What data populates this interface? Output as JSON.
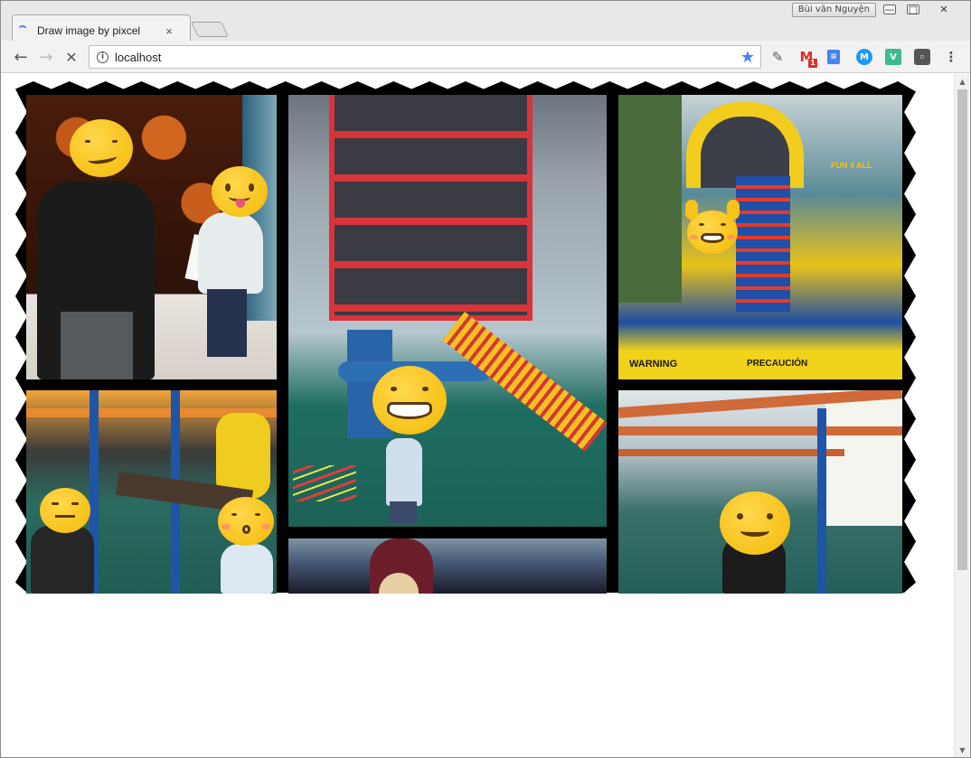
{
  "browser": {
    "user_name": "Bùi văn Nguyện",
    "tab": {
      "title": "Draw image by pixcel",
      "close_glyph": "×"
    },
    "address_bar": {
      "url": "localhost"
    },
    "window_controls": {
      "minimize": "—",
      "maximize": "□",
      "close": "✕"
    },
    "extensions": [
      {
        "name": "eyedropper-icon",
        "glyph": "✎"
      },
      {
        "name": "gmail-icon",
        "glyph": "M",
        "badge": "1"
      },
      {
        "name": "docs-icon",
        "glyph": "≡"
      },
      {
        "name": "m-extension-icon",
        "glyph": "M"
      },
      {
        "name": "v-extension-icon",
        "glyph": "V"
      },
      {
        "name": "bulb-extension-icon",
        "glyph": "◦"
      }
    ],
    "menu_glyph": "⋮"
  },
  "colors": {
    "accent": "#4285f4",
    "gmail": "#d93025",
    "chrome_bg": "#f2f2f2",
    "titlebar_bg": "#e8e8e8"
  },
  "page": {
    "collage": {
      "photo_text": {
        "warning": "WARNING",
        "precaucion": "PRECAUCIÓN",
        "sign": "FUN 4 ALL"
      },
      "photos": [
        {
          "subject": "pumpkin-wall",
          "faces": [
            "smirk",
            "tongue"
          ]
        },
        {
          "subject": "play-structure-tower",
          "faces": [
            "laughing"
          ]
        },
        {
          "subject": "bounce-house",
          "faces": [
            "cheering"
          ]
        },
        {
          "subject": "indoor-playground",
          "faces": [
            "unamused",
            "kissing"
          ]
        },
        {
          "subject": "ceiling",
          "faces": []
        },
        {
          "subject": "monkey-bars",
          "faces": [
            "smile"
          ]
        }
      ]
    }
  }
}
